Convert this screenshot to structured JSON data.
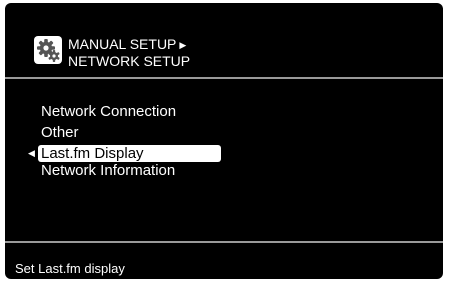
{
  "header": {
    "icon": "gear-icon",
    "breadcrumb_1": "MANUAL SETUP",
    "breadcrumb_arrow": "▶",
    "breadcrumb_2": "NETWORK SETUP"
  },
  "menu": {
    "selection_marker": "◀",
    "items": [
      {
        "label": "Network Connection",
        "selected": false
      },
      {
        "label": "Other",
        "selected": false
      },
      {
        "label": "Last.fm Display",
        "selected": true
      },
      {
        "label": "Network Information",
        "selected": false
      }
    ]
  },
  "footer": {
    "help_text": "Set Last.fm display"
  },
  "colors": {
    "background": "#000000",
    "text": "#ffffff",
    "highlight": "#ffffff",
    "highlight_text": "#000000",
    "divider": "#9a9a9a"
  }
}
